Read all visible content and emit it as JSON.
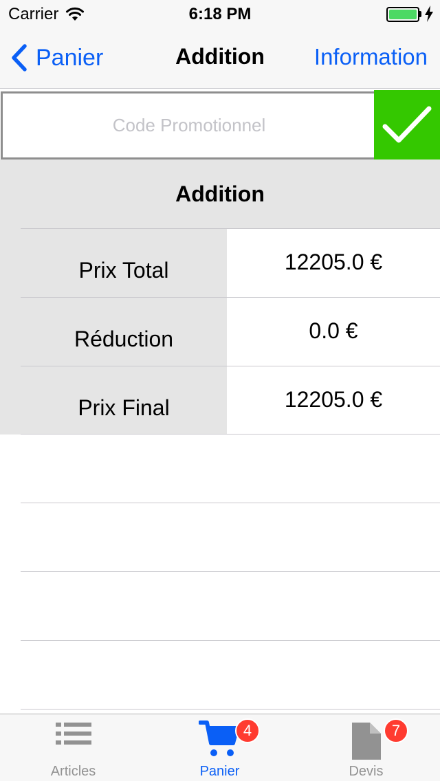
{
  "status_bar": {
    "carrier": "Carrier",
    "time": "6:18 PM"
  },
  "nav": {
    "back_label": "Panier",
    "title": "Addition",
    "right_label": "Information"
  },
  "promo": {
    "placeholder": "Code Promotionnel",
    "value": ""
  },
  "addition": {
    "title": "Addition",
    "rows": [
      {
        "label": "Prix Total",
        "value": "12205.0 €"
      },
      {
        "label": "Réduction",
        "value": "0.0 €"
      },
      {
        "label": "Prix Final",
        "value": "12205.0 €"
      }
    ]
  },
  "tab_bar": {
    "tabs": [
      {
        "label": "Articles",
        "icon": "list-icon"
      },
      {
        "label": "Panier",
        "icon": "cart-icon",
        "badge": "4",
        "active": true
      },
      {
        "label": "Devis",
        "icon": "document-icon",
        "badge": "7"
      }
    ]
  },
  "colors": {
    "accent": "#0a5ff6",
    "confirm": "#34c800",
    "badge": "#ff3b30",
    "section_bg": "#e5e5e5",
    "battery": "#4cd964"
  }
}
